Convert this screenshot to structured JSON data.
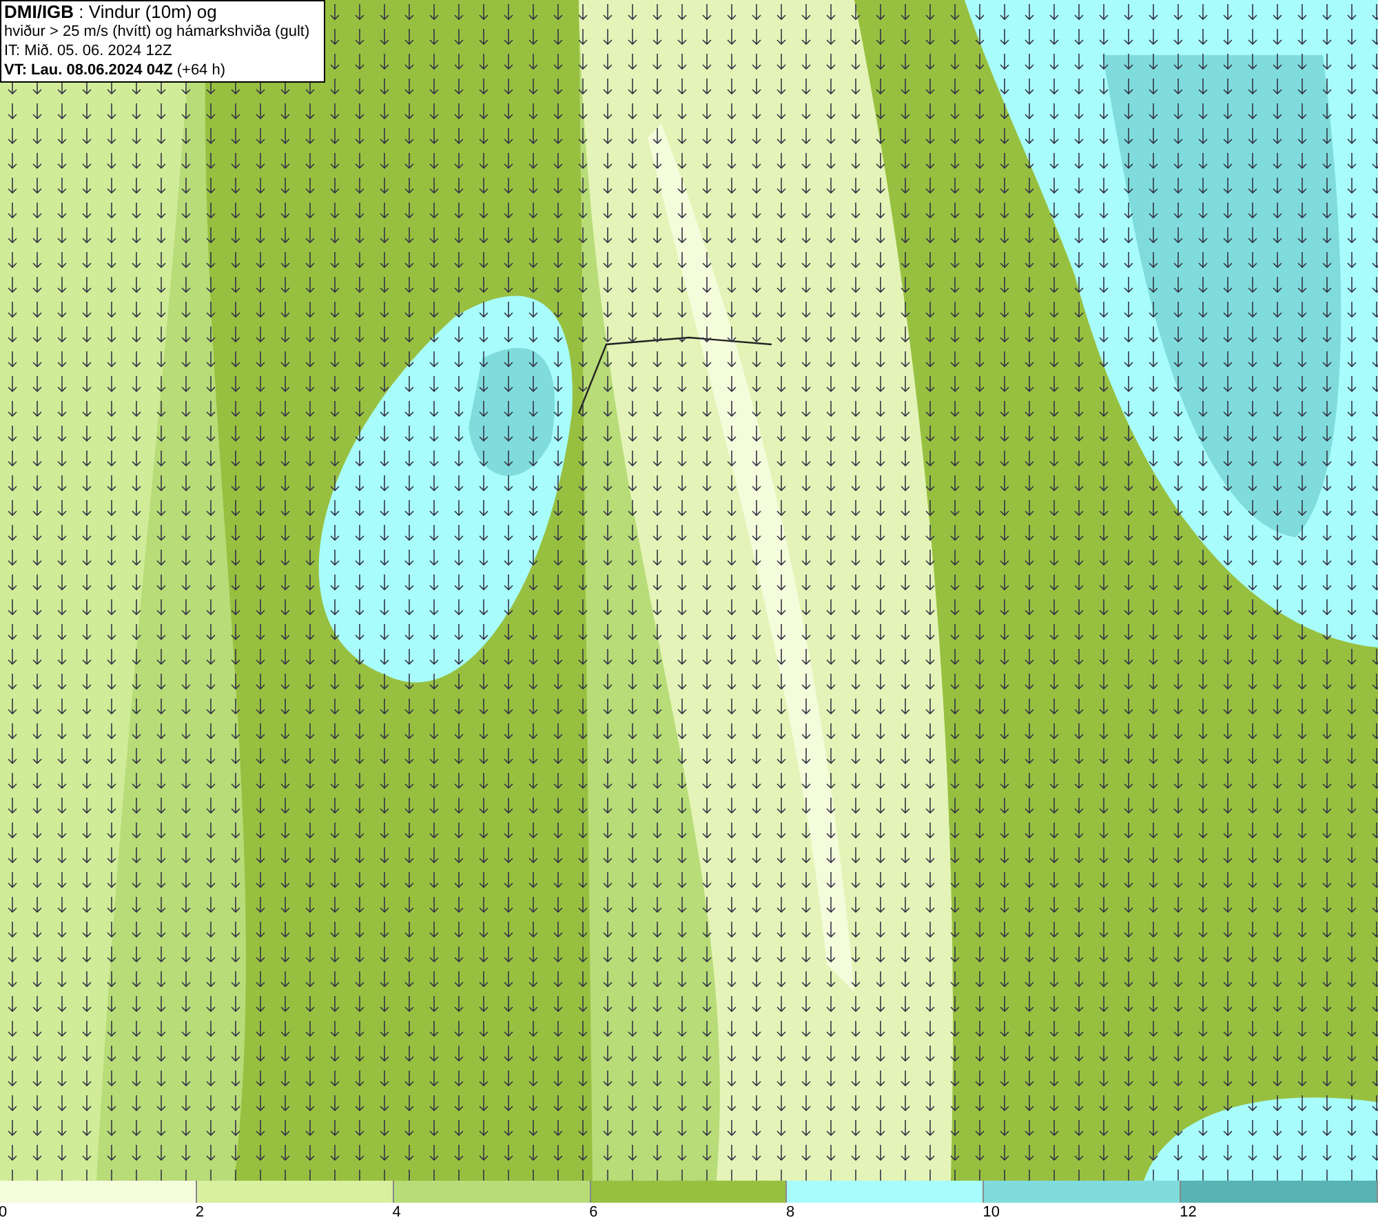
{
  "header": {
    "lines": [
      "**DMI/IGB** : Vindur (10m) og",
      "hviður > 25 m/s (hvítt) og hámarkshviða (gult)",
      "IT: Mið. 05. 06. 2024 12Z",
      "**VT: Lau. 08.06.2024 04Z** (+64 h)"
    ]
  },
  "legend": {
    "items": [
      {
        "label": "0",
        "color": "#f5fcdc"
      },
      {
        "label": "2",
        "color": "#d8f0a0"
      },
      {
        "label": "4",
        "color": "#b8dc78"
      },
      {
        "label": "6",
        "color": "#98c040"
      },
      {
        "label": "8",
        "color": "#a8fcfc"
      },
      {
        "label": "10",
        "color": "#80dcdc"
      },
      {
        "label": "12",
        "color": "#58b4b4"
      }
    ]
  }
}
